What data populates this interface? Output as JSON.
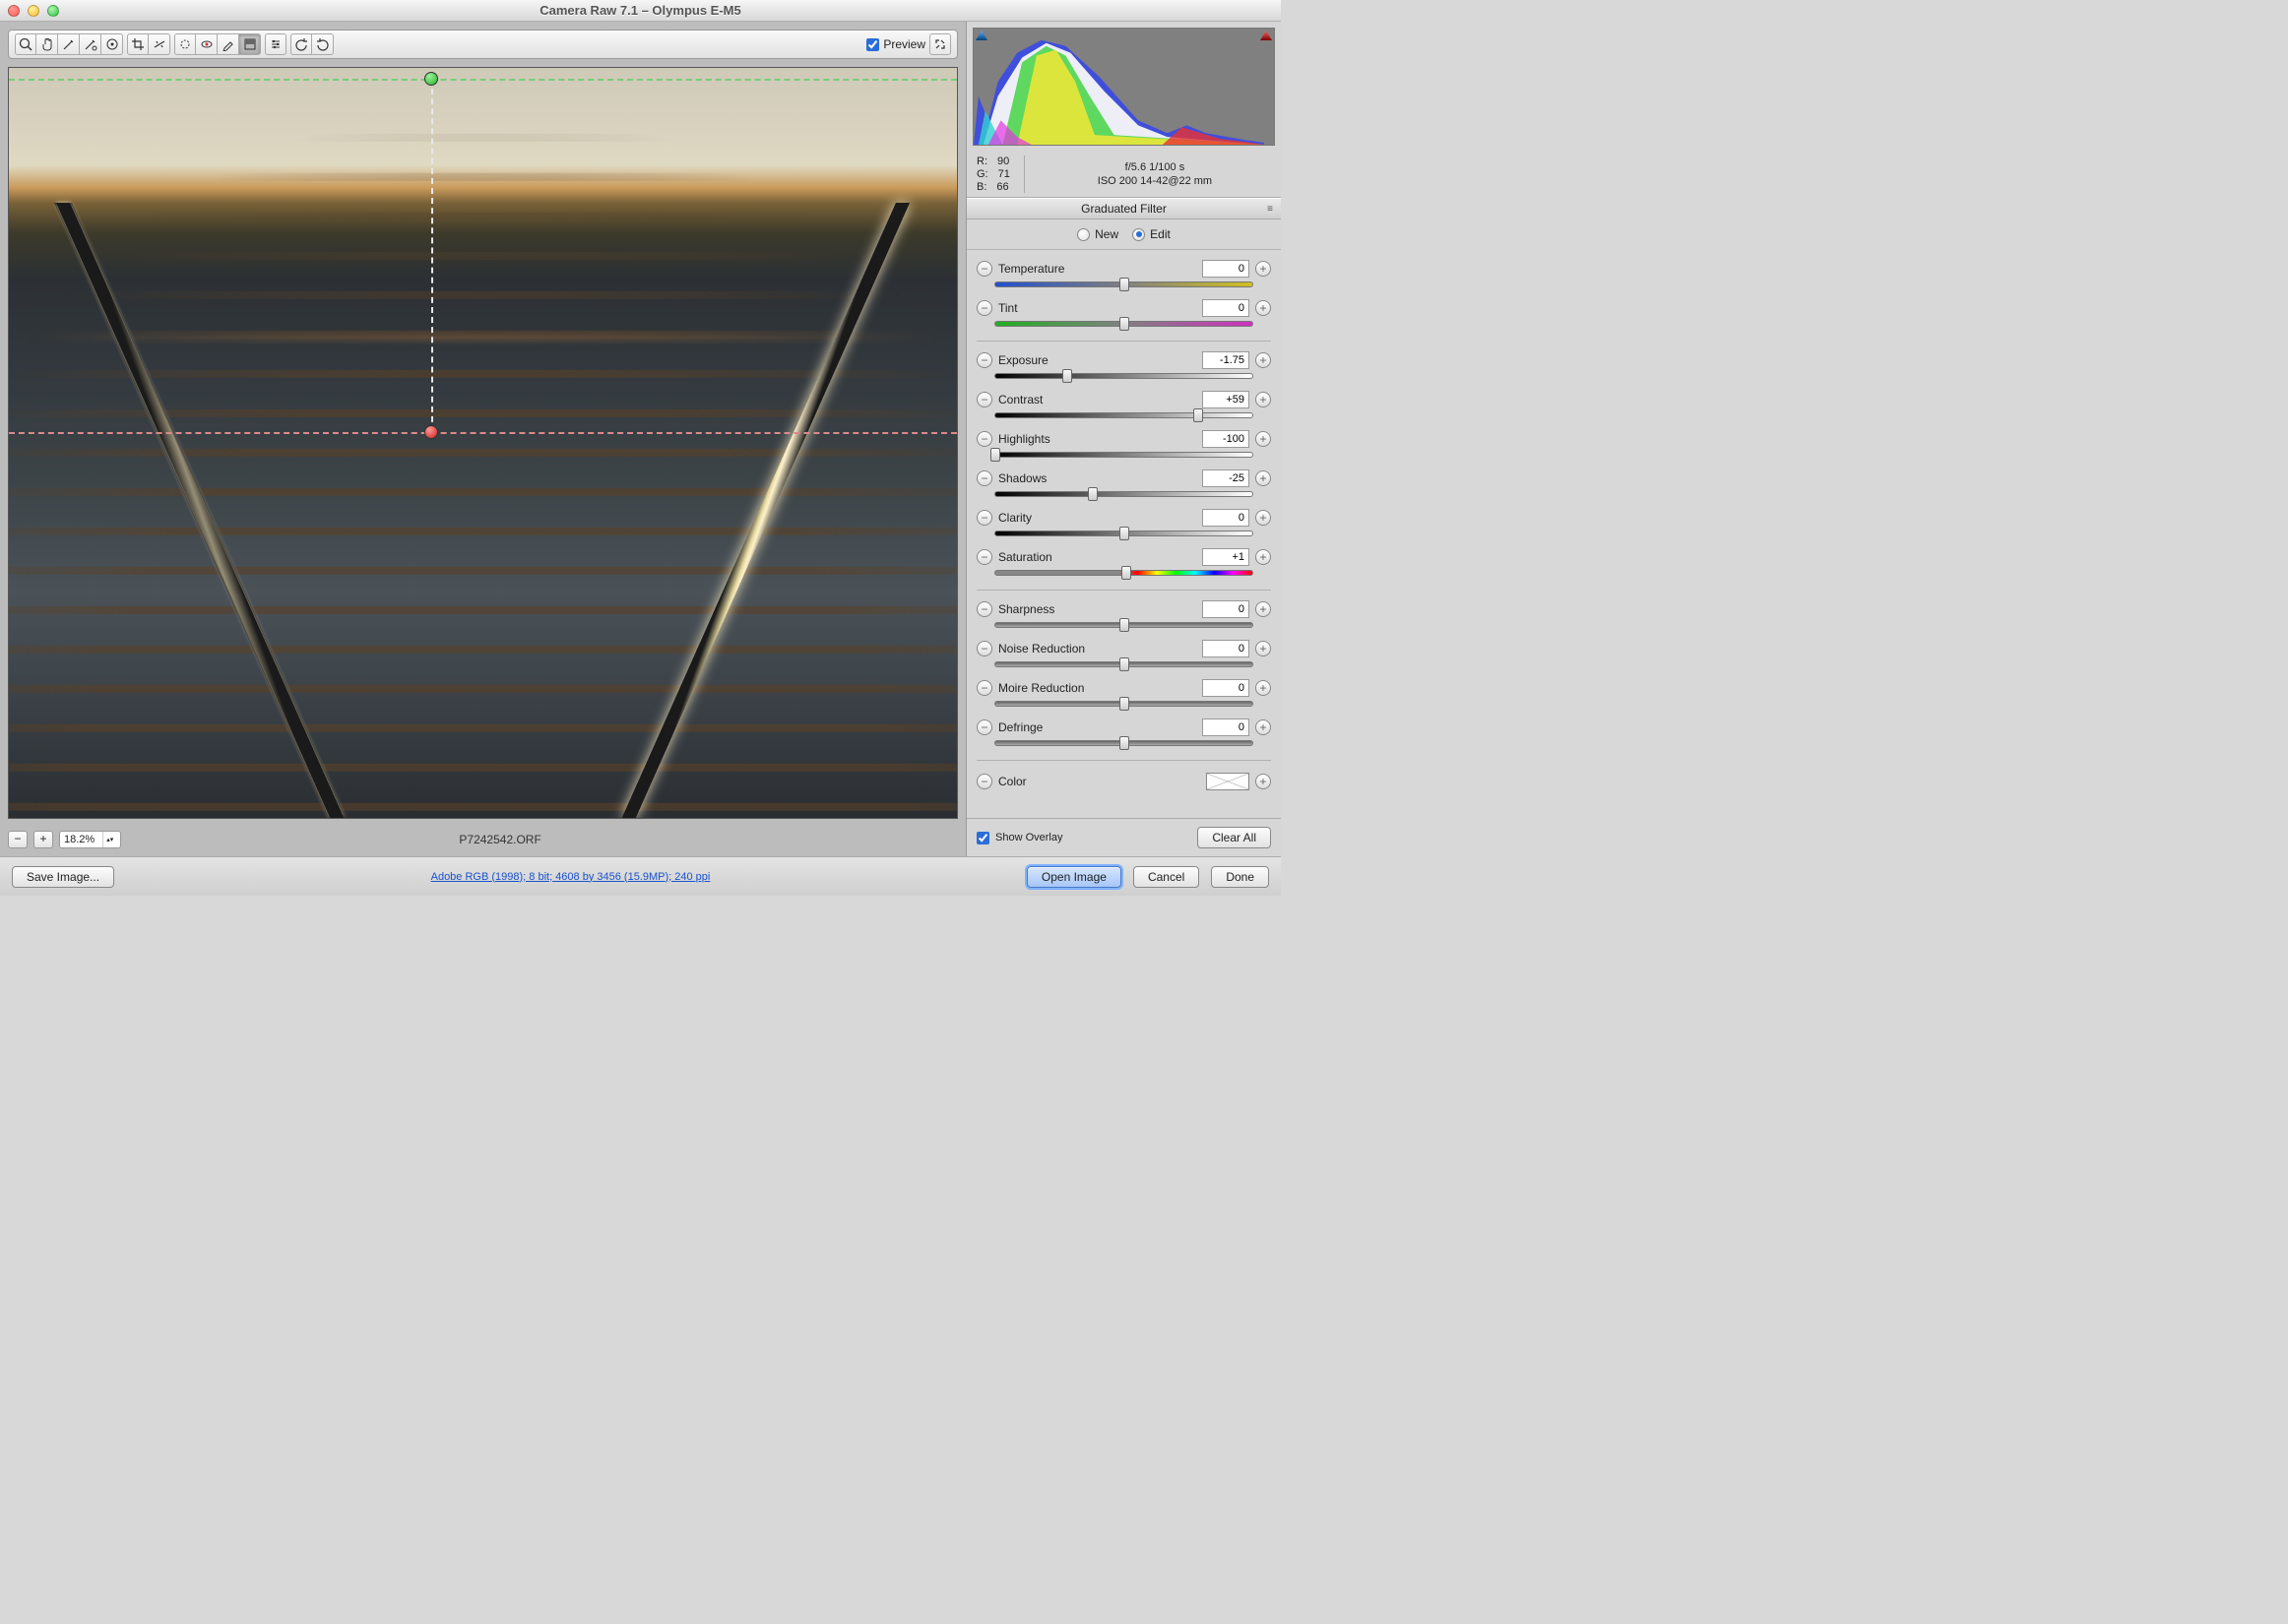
{
  "window": {
    "title": "Camera Raw 7.1  –  Olympus E-M5"
  },
  "toolbar": {
    "preview_label": "Preview",
    "preview_checked": true
  },
  "zoom": {
    "out": "−",
    "in": "+",
    "level": "18.2%"
  },
  "file": {
    "name": "P7242542.ORF"
  },
  "rgb": {
    "r_label": "R:",
    "r": "90",
    "g_label": "G:",
    "g": "71",
    "b_label": "B:",
    "b": "66"
  },
  "exif": {
    "line1": "f/5.6   1/100 s",
    "line2": "ISO 200    14-42@22 mm"
  },
  "panel": {
    "title": "Graduated Filter"
  },
  "mode": {
    "new": "New",
    "edit": "Edit"
  },
  "sliders": {
    "temperature": {
      "label": "Temperature",
      "value": "0",
      "pos": 50
    },
    "tint": {
      "label": "Tint",
      "value": "0",
      "pos": 50
    },
    "exposure": {
      "label": "Exposure",
      "value": "-1.75",
      "pos": 28
    },
    "contrast": {
      "label": "Contrast",
      "value": "+59",
      "pos": 79
    },
    "highlights": {
      "label": "Highlights",
      "value": "-100",
      "pos": 0
    },
    "shadows": {
      "label": "Shadows",
      "value": "-25",
      "pos": 38
    },
    "clarity": {
      "label": "Clarity",
      "value": "0",
      "pos": 50
    },
    "saturation": {
      "label": "Saturation",
      "value": "+1",
      "pos": 51
    },
    "sharpness": {
      "label": "Sharpness",
      "value": "0",
      "pos": 50
    },
    "noise": {
      "label": "Noise Reduction",
      "value": "0",
      "pos": 50
    },
    "moire": {
      "label": "Moire Reduction",
      "value": "0",
      "pos": 50
    },
    "defringe": {
      "label": "Defringe",
      "value": "0",
      "pos": 50
    }
  },
  "color": {
    "label": "Color"
  },
  "overlay": {
    "label": "Show Overlay",
    "clear": "Clear All"
  },
  "footer": {
    "save": "Save Image...",
    "workflow": "Adobe RGB (1998); 8 bit; 4608 by 3456 (15.9MP); 240 ppi",
    "open": "Open Image",
    "cancel": "Cancel",
    "done": "Done"
  }
}
